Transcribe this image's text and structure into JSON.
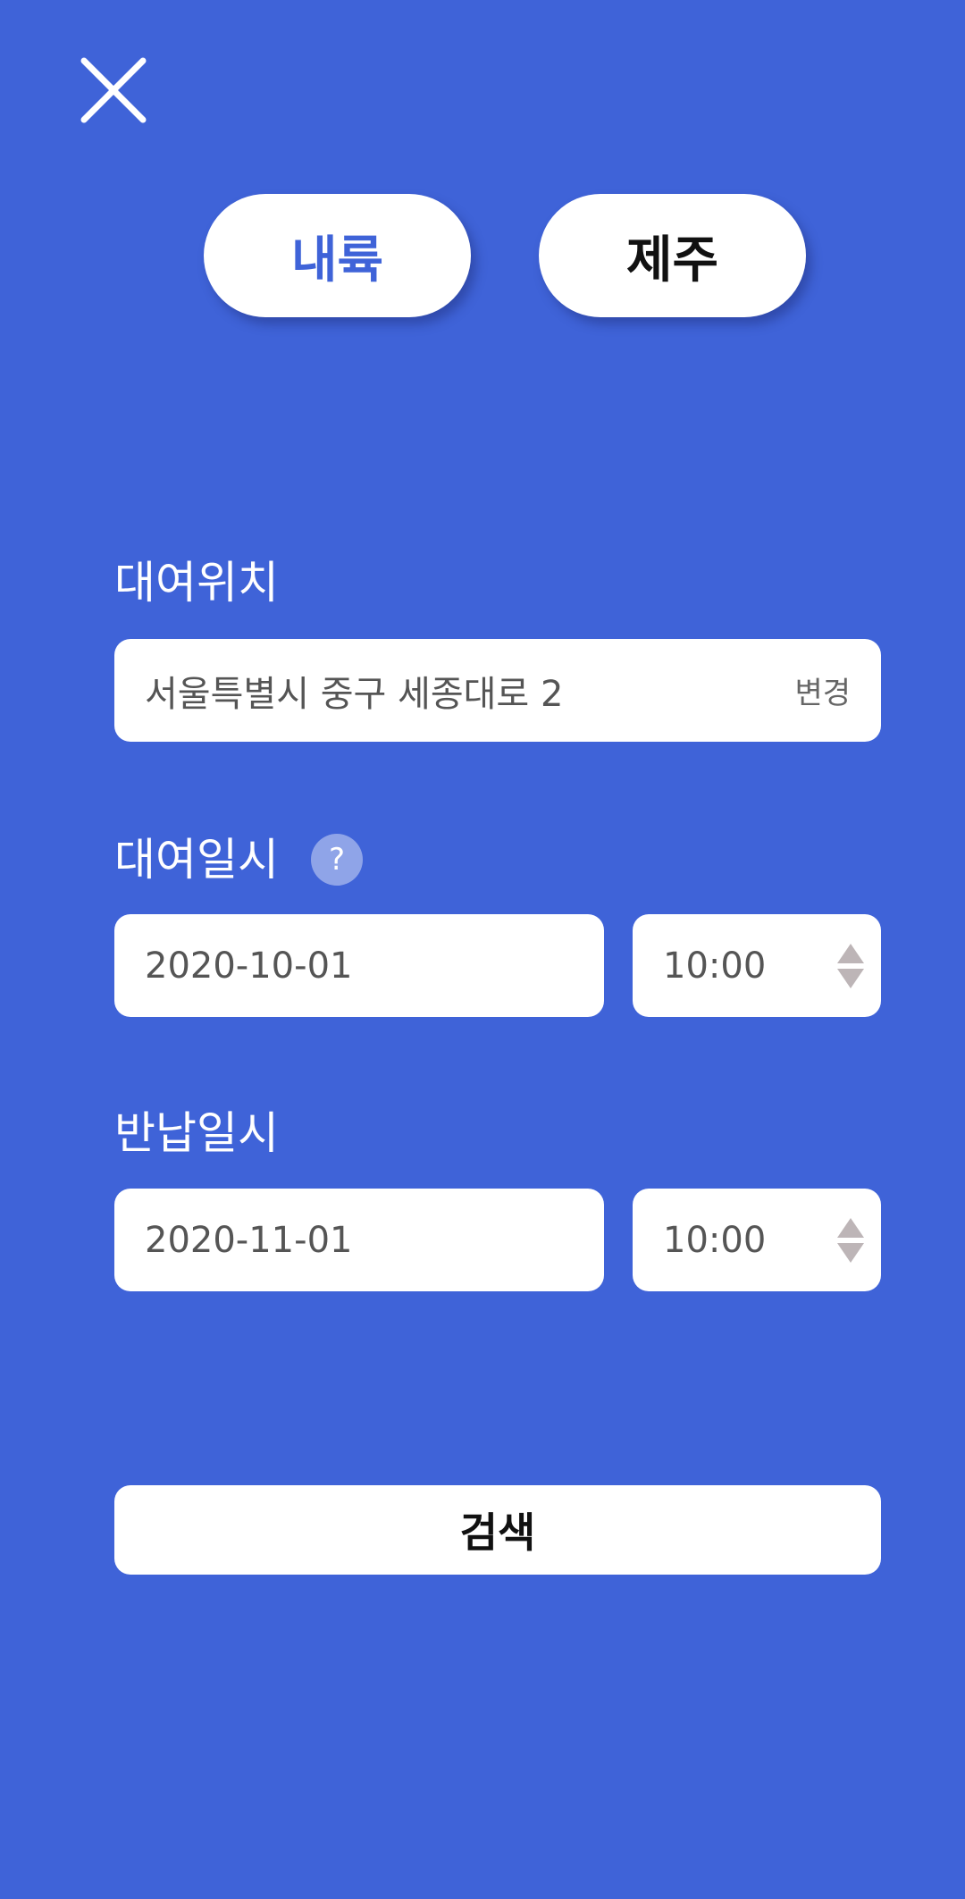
{
  "tabs": {
    "mainland": "내륙",
    "jeju": "제주"
  },
  "rental_location": {
    "label": "대여위치",
    "address": "서울특별시 중구 세종대로 2",
    "change": "변경"
  },
  "rental_datetime": {
    "label": "대여일시",
    "help": "?",
    "date": "2020-10-01",
    "time": "10:00"
  },
  "return_datetime": {
    "label": "반납일시",
    "date": "2020-11-01",
    "time": "10:00"
  },
  "search": {
    "label": "검색"
  }
}
